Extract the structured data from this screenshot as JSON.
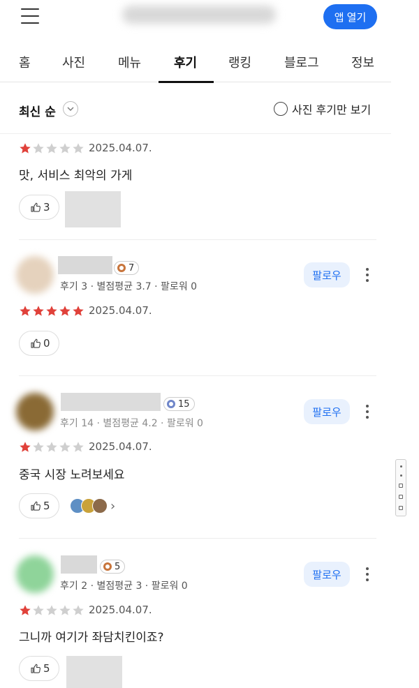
{
  "header": {
    "open_app_label": "앱 열기"
  },
  "tabs": [
    {
      "label": "홈"
    },
    {
      "label": "사진"
    },
    {
      "label": "메뉴"
    },
    {
      "label": "후기",
      "active": true
    },
    {
      "label": "랭킹"
    },
    {
      "label": "블로그"
    },
    {
      "label": "정보"
    }
  ],
  "sort": {
    "label": "최신 순",
    "photo_only_label": "사진 후기만 보기"
  },
  "follow_label": "팔로우",
  "colors": {
    "accent": "#1e6ff1",
    "star_on": "#e0413a",
    "star_off": "#cfcfcf"
  },
  "reviews": [
    {
      "rating": 1,
      "date": "2025.04.07.",
      "text": "맛, 서비스 최악의 가게",
      "likes": "3"
    },
    {
      "level": "7",
      "level_color": "#c8753c",
      "meta": "후기 3 · 별점평균 3.7 · 팔로워 0",
      "rating": 5,
      "date": "2025.04.07.",
      "likes": "0"
    },
    {
      "level": "15",
      "level_color": "#6f86c9",
      "meta": "후기 14 · 별점평균 4.2 · 팔로워 0",
      "rating": 1,
      "date": "2025.04.07.",
      "text": "중국 시장 노려보세요",
      "likes": "5"
    },
    {
      "level": "5",
      "level_color": "#c8753c",
      "meta": "후기 2 · 별점평균 3 · 팔로워 0",
      "rating": 1,
      "date": "2025.04.07.",
      "text": "그니까 여기가 좌담치킨이죠?",
      "likes": "5"
    }
  ]
}
